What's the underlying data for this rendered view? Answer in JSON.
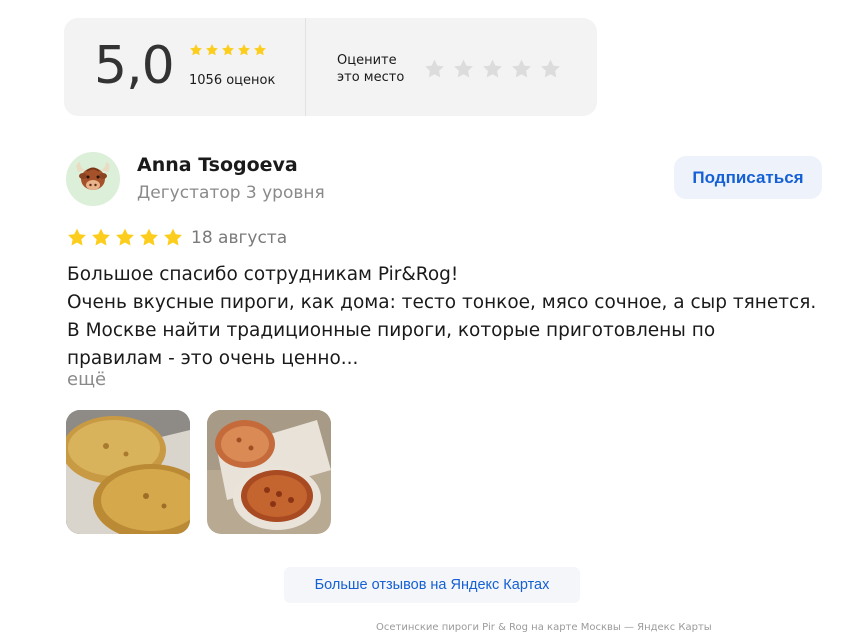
{
  "summary": {
    "score": "5,0",
    "stars_filled": 5,
    "count_label": "1056 оценок",
    "rate_prompt_line1": "Оцените",
    "rate_prompt_line2": "это место"
  },
  "review": {
    "author_name": "Anna Tsogoeva",
    "author_level": "Дегустатор 3 уровня",
    "subscribe_label": "Подписаться",
    "rating": 5,
    "date": "18 августа",
    "text_lines": [
      "Большое спасибо сотрудникам Pir&Rog!",
      "Очень вкусные пироги, как дома: тесто тонкое, мясо сочное, а сыр тянется.",
      "В Москве найти традиционные пироги, которые приготовлены по",
      "правилам - это очень ценно..."
    ],
    "more_label": "ещё",
    "photos": [
      "pie-photo-1",
      "pie-photo-2"
    ]
  },
  "more_reviews_label": "Больше отзывов на Яндекс Картах",
  "footer_text": "Осетинские пироги Pir & Rog на карте Москвы — Яндекс Карты",
  "colors": {
    "star_gold": "#fccd1c",
    "star_empty": "#dcdcdc",
    "link_blue": "#1560d4",
    "panel_bg": "#f3f3f3"
  }
}
